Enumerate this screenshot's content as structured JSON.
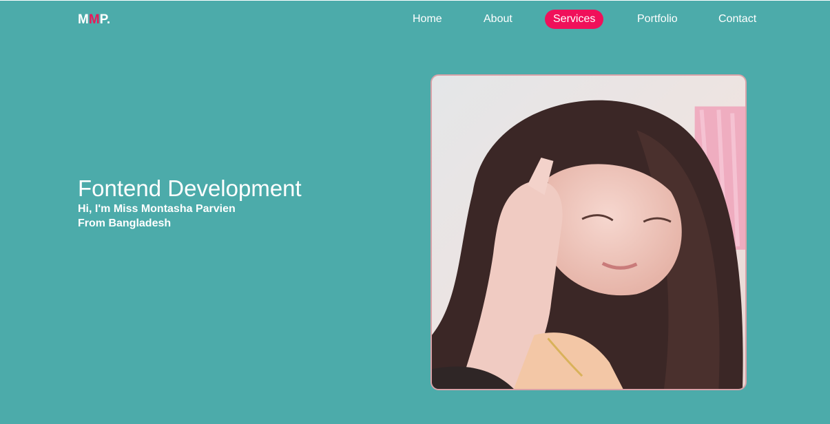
{
  "brand": {
    "logo_part1": "M",
    "logo_part2": "M",
    "logo_part3": "P."
  },
  "nav": {
    "items": [
      {
        "label": "Home"
      },
      {
        "label": "About"
      },
      {
        "label": "Services",
        "active": true
      },
      {
        "label": "Portfolio"
      },
      {
        "label": "Contact"
      }
    ]
  },
  "hero": {
    "title": "Fontend Development",
    "intro": "Hi, I'm Miss Montasha Parvien",
    "origin": "From Bangladesh"
  },
  "colors": {
    "background": "#4cabaa",
    "accent": "#f0105a",
    "logo_accent": "#e8195a",
    "photo_border": "#d8a2a8"
  }
}
